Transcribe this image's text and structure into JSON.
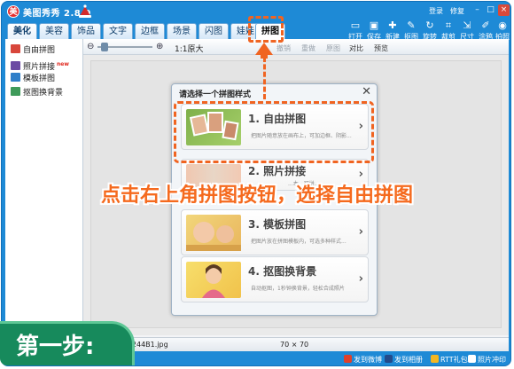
{
  "window": {
    "title": "美图秀秀 2.8.9",
    "links": [
      "登录",
      "修复"
    ]
  },
  "tabs": [
    "美化",
    "美容",
    "饰品",
    "文字",
    "边框",
    "场景",
    "闪图",
    "娃娃",
    "拼图"
  ],
  "active_tab": "拼图",
  "toolbar": [
    {
      "label": "打开",
      "icon": "folder-icon",
      "glyph": "▭"
    },
    {
      "label": "保存",
      "icon": "save-icon",
      "glyph": "▣"
    },
    {
      "label": "新建",
      "icon": "new-icon",
      "glyph": "✚"
    },
    {
      "label": "抠图",
      "icon": "cutout-icon",
      "glyph": "✎"
    },
    {
      "label": "旋转",
      "icon": "rotate-icon",
      "glyph": "↻"
    },
    {
      "label": "裁剪",
      "icon": "crop-icon",
      "glyph": "⌗"
    },
    {
      "label": "尺寸",
      "icon": "resize-icon",
      "glyph": "⇲"
    },
    {
      "label": "涂鸦",
      "icon": "brush-icon",
      "glyph": "✐"
    },
    {
      "label": "拍照",
      "icon": "camera-icon",
      "glyph": "◉"
    }
  ],
  "sidebar": {
    "items": [
      "自由拼图",
      "照片拼接",
      "模板拼图",
      "抠图换背景"
    ],
    "hot_badge": "new"
  },
  "work_bar": {
    "zoom_ratio": "1:1原大",
    "items": [
      "撤销",
      "重做",
      "原图",
      "对比",
      "预览"
    ]
  },
  "status": {
    "file_name": "x09244B1.jpg",
    "image_size": "70 × 70"
  },
  "bottom_bar": [
    "发到微博",
    "发到相册",
    "RTT礼包",
    "照片冲印"
  ],
  "dialog": {
    "title": "请选择一个拼图样式",
    "cards": [
      {
        "title": "1. 自由拼图",
        "desc": "把图片随意放在画布上，可加边框、阴影..."
      },
      {
        "title": "2. 照片拼接",
        "desc": "...本，可拼..."
      },
      {
        "title": "3. 模板拼图",
        "desc": "把图片放在拼图模板内，可选多种样式..."
      },
      {
        "title": "4. 抠图换背景",
        "desc": "自动抠图，1秒钟换背景，轻松合成照片"
      }
    ]
  },
  "instruction": "点击右上角拼图按钮，选择自由拼图",
  "step_label": "第一步:",
  "colors": {
    "brand_blue": "#1e8ad6",
    "highlight_orange": "#f06421",
    "step_green": "#178a5c"
  }
}
